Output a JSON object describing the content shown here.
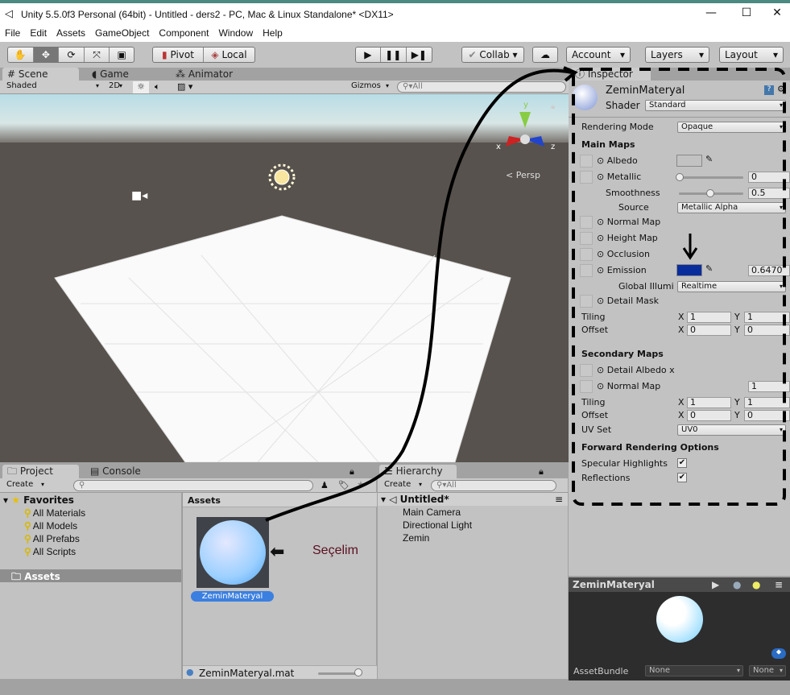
{
  "window": {
    "title": "Unity 5.5.0f3 Personal (64bit) - Untitled - ders2 - PC, Mac & Linux Standalone* <DX11>",
    "minimize": "—",
    "maximize": "☐",
    "close": "✕"
  },
  "menu": [
    "File",
    "Edit",
    "Assets",
    "GameObject",
    "Component",
    "Window",
    "Help"
  ],
  "toolbar": {
    "tools": [
      "hand-icon",
      "move-icon",
      "rotate-icon",
      "scale-icon",
      "rect-icon"
    ],
    "pivot": "Pivot",
    "local": "Local",
    "collab": "Collab",
    "account": "Account",
    "layers": "Layers",
    "layout": "Layout"
  },
  "scene": {
    "tabs": [
      "Scene",
      "Game",
      "Animator"
    ],
    "shading": "Shaded",
    "mode2d": "2D",
    "gizmos": "Gizmos",
    "search": "All",
    "persp": "Persp",
    "axes": {
      "y": "y",
      "x": "x",
      "z": "z"
    },
    "sky_color": "#c9e3ea",
    "ground_color": "#57524d"
  },
  "inspector": {
    "tab": "Inspector",
    "material_name": "ZeminMateryal",
    "shader_label": "Shader",
    "shader": "Standard",
    "rendering_mode_label": "Rendering Mode",
    "rendering_mode": "Opaque",
    "main_maps": "Main Maps",
    "albedo": "Albedo",
    "albedo_color": "#ffffff",
    "metallic": "Metallic",
    "metallic_value": "0",
    "smoothness": "Smoothness",
    "smoothness_value": "0.5",
    "source": "Source",
    "source_value": "Metallic Alpha",
    "normal_map": "Normal Map",
    "height_map": "Height Map",
    "occlusion": "Occlusion",
    "emission": "Emission",
    "emission_color": "#0a2d9c",
    "emission_value": "0.6470",
    "gi": "Global Illumi",
    "gi_value": "Realtime",
    "detail_mask": "Detail Mask",
    "tiling": "Tiling",
    "offset": "Offset",
    "x": "X",
    "y": "Y",
    "tiling_x": "1",
    "tiling_y": "1",
    "offset_x": "0",
    "offset_y": "0",
    "secondary_maps": "Secondary Maps",
    "detail_albedo": "Detail Albedo x",
    "normal_map2": "Normal Map",
    "normal_map2_value": "1",
    "tiling2_x": "1",
    "tiling2_y": "1",
    "offset2_x": "0",
    "offset2_y": "0",
    "uv_set": "UV Set",
    "uv_set_value": "UV0",
    "forward": "Forward Rendering Options",
    "specular": "Specular Highlights",
    "specular_checked": true,
    "reflections": "Reflections",
    "reflections_checked": true
  },
  "preview": {
    "title": "ZeminMateryal",
    "assetbundle": "AssetBundle",
    "bundle": "None",
    "variant": "None"
  },
  "project": {
    "tabs": [
      "Project",
      "Console"
    ],
    "create": "Create",
    "favorites": "Favorites",
    "fav_items": [
      "All Materials",
      "All Models",
      "All Prefabs",
      "All Scripts"
    ],
    "assets_folder": "Assets",
    "assets_header": "Assets",
    "asset_name": "ZeminMateryal",
    "selected_file": "ZeminMateryal.mat",
    "annotation": "Seçelim"
  },
  "hierarchy": {
    "tab": "Hierarchy",
    "create": "Create",
    "search": "All",
    "scene": "Untitled*",
    "items": [
      "Main Camera",
      "Directional Light",
      "Zemin"
    ]
  }
}
